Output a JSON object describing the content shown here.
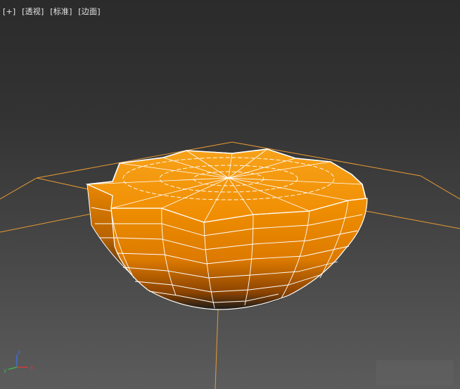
{
  "viewport": {
    "labels": [
      {
        "text": "[+]"
      },
      {
        "text": "[透视]"
      },
      {
        "text": "[标准]"
      },
      {
        "text": "[边面]"
      }
    ]
  },
  "gizmo": {
    "axes": [
      {
        "name": "x",
        "label": "x",
        "color": "#d33a3a"
      },
      {
        "name": "y",
        "label": "y",
        "color": "#3db14a"
      },
      {
        "name": "z",
        "label": "z",
        "color": "#3f6fd8"
      }
    ]
  },
  "colors": {
    "mesh_orange": "#f08a00",
    "mesh_orange_dark": "#b25800",
    "wire_white": "#ffffff",
    "grid_orange": "#e79a34"
  }
}
